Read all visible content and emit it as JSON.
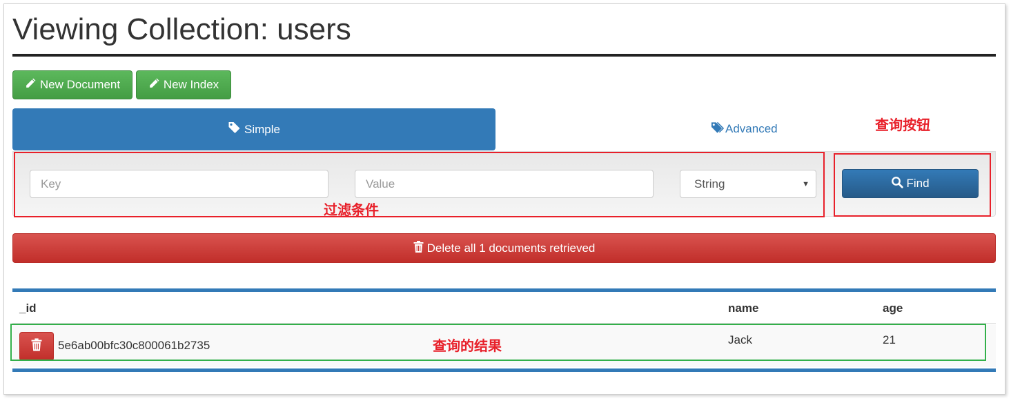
{
  "page": {
    "title": "Viewing Collection: users"
  },
  "toolbar": {
    "new_document": "New Document",
    "new_index": "New Index"
  },
  "tabs": {
    "simple": "Simple",
    "advanced": "Advanced"
  },
  "filter": {
    "key_placeholder": "Key",
    "value_placeholder": "Value",
    "type_selected": "String",
    "find_label": "Find"
  },
  "delete_all": "Delete all 1 documents retrieved",
  "table": {
    "columns": [
      "_id",
      "name",
      "age"
    ],
    "rows": [
      {
        "_id": "5e6ab00bfc30c800061b2735",
        "name": "Jack",
        "age": "21"
      }
    ]
  },
  "annotations": {
    "query_button": "查询按钮",
    "filter_conditions": "过滤条件",
    "query_results": "查询的结果"
  },
  "colors": {
    "primary": "#337ab7",
    "success": "#5cb85c",
    "danger": "#d9534f",
    "annotation_red": "#e8202a",
    "annotation_green": "#33b04a"
  }
}
